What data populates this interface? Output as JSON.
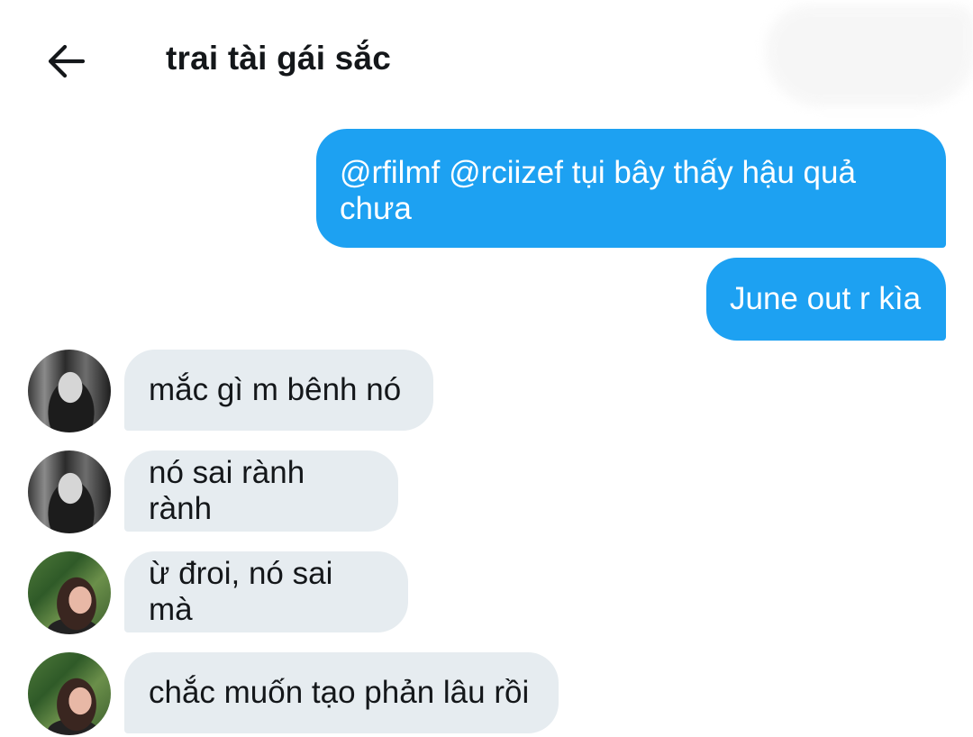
{
  "header": {
    "back_icon": "arrow-left-icon",
    "title": "trai tài gái sắc"
  },
  "colors": {
    "outgoing_bubble": "#1da1f2",
    "incoming_bubble": "#e6ecf0",
    "text": "#14171a"
  },
  "messages": [
    {
      "direction": "outgoing",
      "text": "@rfilmf @rciizef tụi bây thấy hậu quả chưa"
    },
    {
      "direction": "outgoing",
      "text": "June out r kìa"
    },
    {
      "direction": "incoming",
      "sender_avatar": "avatar-user-a",
      "text": "mắc gì m bênh nó"
    },
    {
      "direction": "incoming",
      "sender_avatar": "avatar-user-a",
      "text": "nó sai rành rành"
    },
    {
      "direction": "incoming",
      "sender_avatar": "avatar-user-b",
      "text": "ừ đroi, nó sai mà"
    },
    {
      "direction": "incoming",
      "sender_avatar": "avatar-user-b",
      "text": "chắc muốn tạo phản lâu rồi"
    }
  ]
}
